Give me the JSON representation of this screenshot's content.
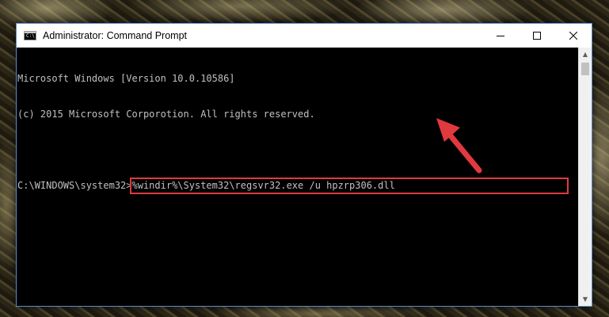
{
  "window": {
    "title": "Administrator: Command Prompt",
    "icon": "cmd-icon",
    "icon_text": "C:\\",
    "controls": [
      "minimize-icon",
      "maximize-icon",
      "close-icon"
    ]
  },
  "console": {
    "lines": [
      "Microsoft Windows [Version 10.0.10586]",
      "(c) 2015 Microsoft Corporotion. All rights reserved.",
      ""
    ],
    "prompt": "C:\\WINDOWS\\system32>",
    "command": "%windir%\\System32\\regsvr32.exe /u hpzrp306.dll"
  },
  "annotation": {
    "highlight_color": "#e0393e",
    "arrow_color": "#e0393e"
  },
  "scrollbar": {
    "up_icon": "scroll-up-arrow-icon",
    "down_icon": "scroll-down-arrow-icon"
  }
}
